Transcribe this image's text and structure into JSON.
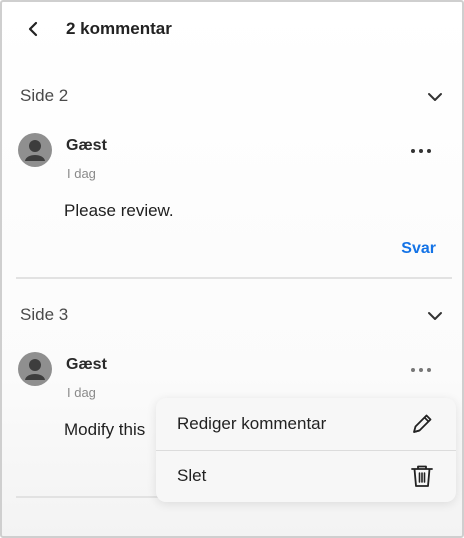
{
  "header": {
    "title": "2 kommentar"
  },
  "sections": [
    {
      "title": "Side 2",
      "comment": {
        "author": "Gæst",
        "time": "I dag",
        "body": "Please review.",
        "reply_label": "Svar"
      }
    },
    {
      "title": "Side 3",
      "comment": {
        "author": "Gæst",
        "time": "I dag",
        "body": "Modify this"
      }
    }
  ],
  "context_menu": {
    "items": [
      {
        "label": "Rediger kommentar",
        "icon": "pencil-icon"
      },
      {
        "label": "Slet",
        "icon": "trash-icon"
      }
    ]
  },
  "colors": {
    "accent": "#1473e6",
    "avatar": "#8f8f8f"
  }
}
